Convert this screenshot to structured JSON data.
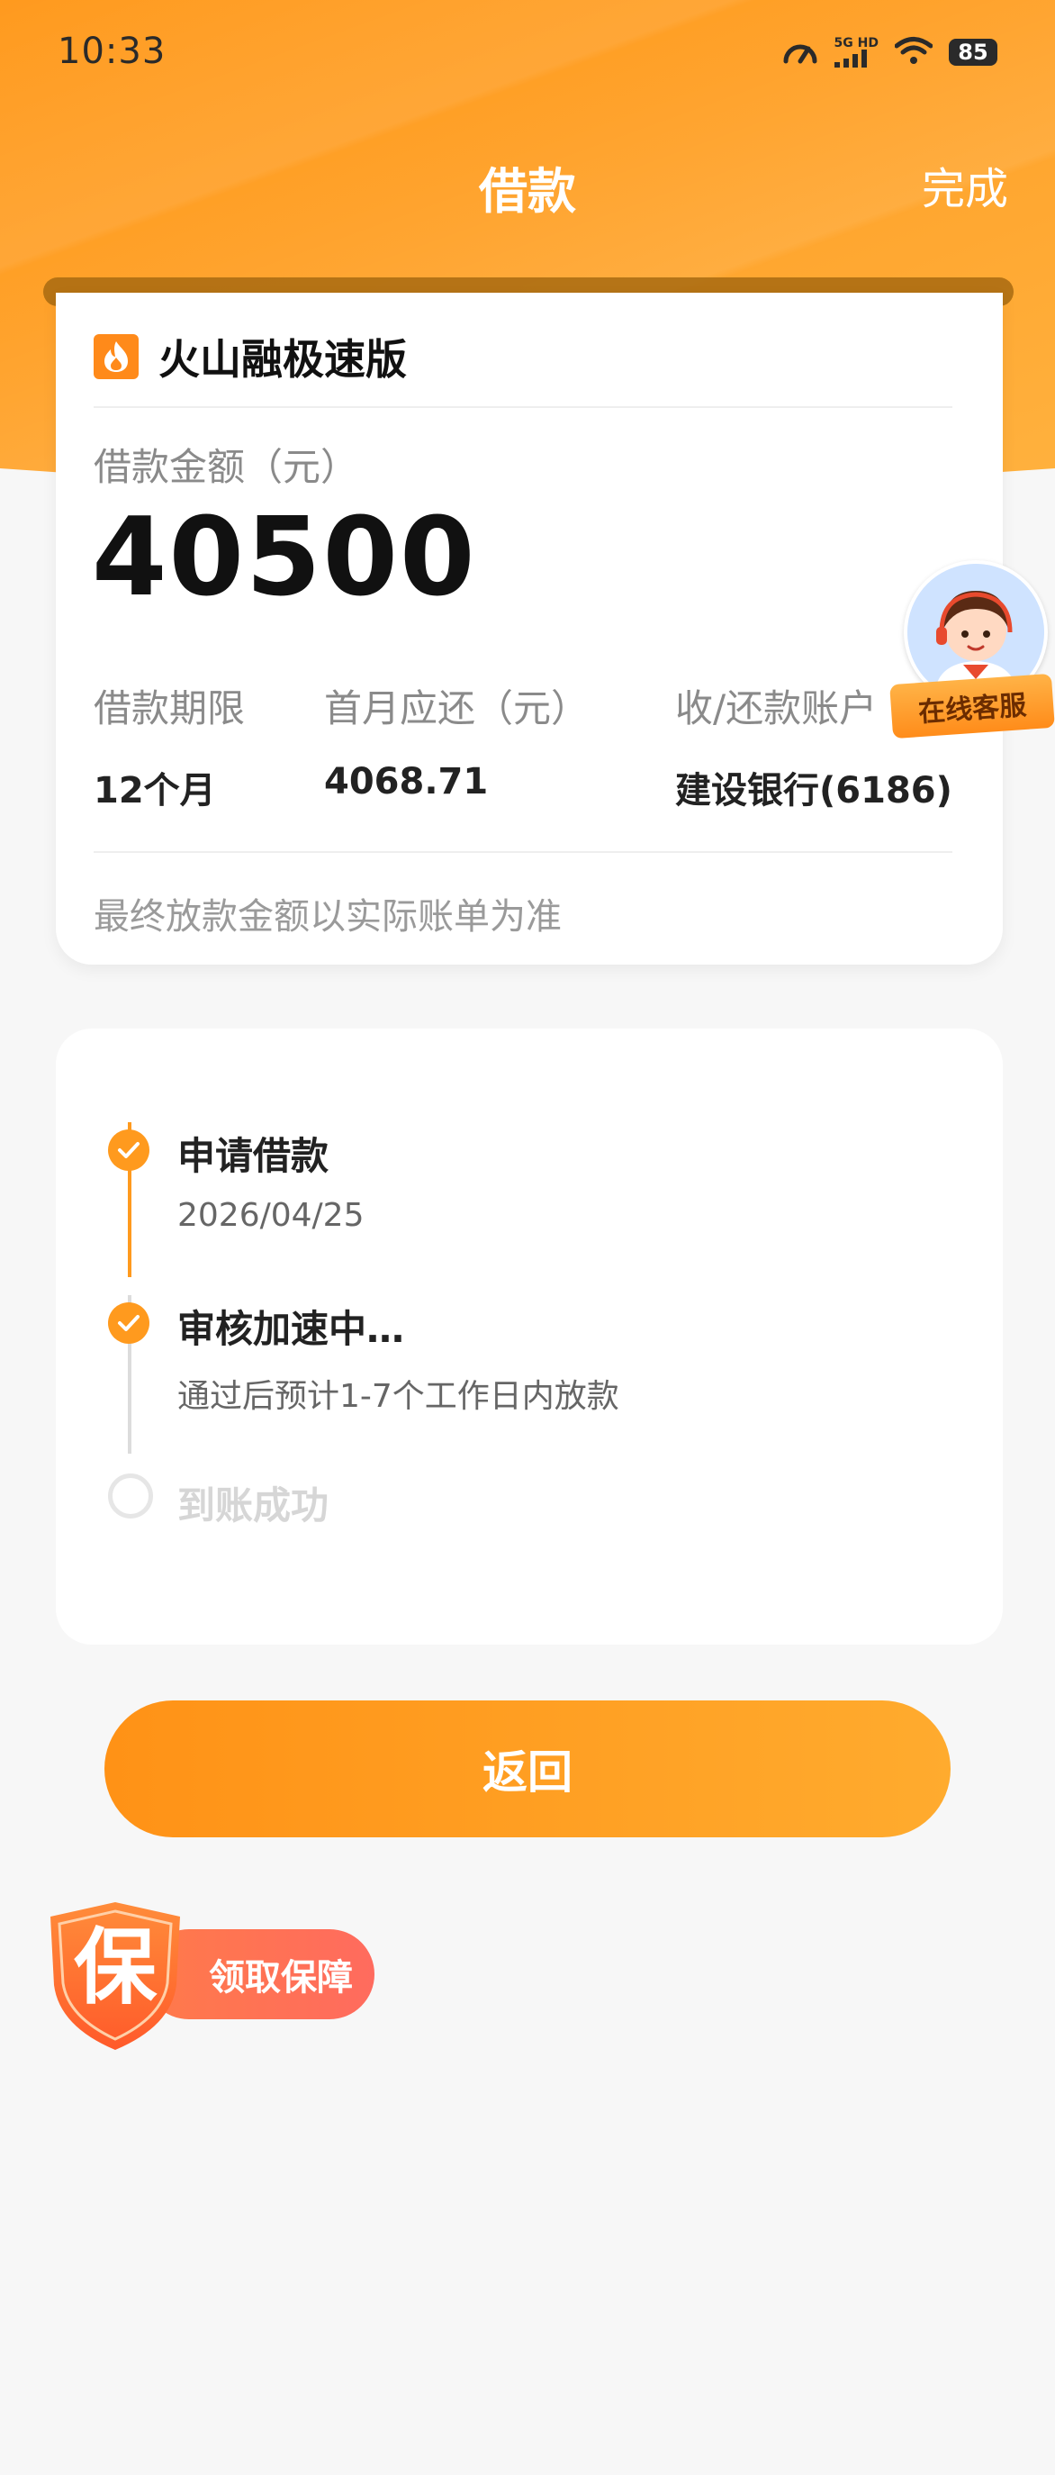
{
  "status_bar": {
    "time": "10:33",
    "network": "5G HD",
    "battery": "85"
  },
  "nav": {
    "title": "借款",
    "done_label": "完成"
  },
  "loan_card": {
    "brand_name": "火山融极速版",
    "amount_label": "借款金额（元）",
    "amount": "40500",
    "term_label": "借款期限",
    "term_value": "12个月",
    "first_payment_label": "首月应还（元）",
    "first_payment_value": "4068.71",
    "account_label": "收/还款账户",
    "account_value": "建设银行(6186)",
    "note": "最终放款金额以实际账单为准"
  },
  "customer_service": {
    "label": "在线客服"
  },
  "progress": {
    "steps": [
      {
        "title": "申请借款",
        "subtitle": "2026/04/25",
        "status": "done"
      },
      {
        "title": "审核加速中…",
        "subtitle": "通过后预计1-7个工作日内放款",
        "status": "done"
      },
      {
        "title": "到账成功",
        "subtitle": "",
        "status": "pending"
      }
    ]
  },
  "back_button": {
    "label": "返回"
  },
  "guarantee": {
    "icon_char": "保",
    "label": "领取保障"
  },
  "colors": {
    "accent": "#ff9a1e",
    "pending": "#d6d6d6"
  }
}
